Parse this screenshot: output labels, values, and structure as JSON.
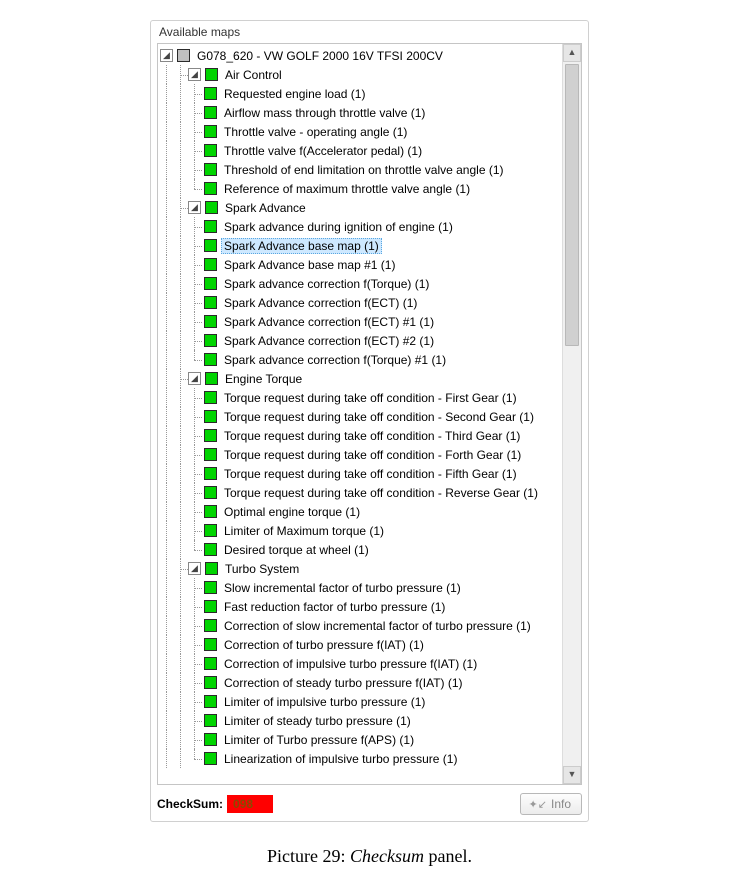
{
  "panel_title": "Available maps",
  "root": {
    "label": "G078_620 - VW GOLF 2000 16V TFSI 200CV",
    "color": "gray"
  },
  "groups": [
    {
      "label": "Air Control",
      "items": [
        "Requested engine load (1)",
        "Airflow mass through throttle valve (1)",
        "Throttle valve - operating angle (1)",
        "Throttle valve f(Accelerator pedal) (1)",
        "Threshold of end limitation on throttle valve angle (1)",
        "Reference of maximum throttle valve angle (1)"
      ]
    },
    {
      "label": "Spark Advance",
      "items": [
        "Spark advance during ignition of engine (1)",
        "Spark Advance base map (1)",
        "Spark Advance base map #1 (1)",
        "Spark advance correction f(Torque) (1)",
        "Spark Advance correction f(ECT) (1)",
        "Spark Advance correction f(ECT) #1 (1)",
        "Spark Advance correction f(ECT) #2 (1)",
        "Spark advance correction f(Torque) #1 (1)"
      ],
      "selected_index": 1
    },
    {
      "label": "Engine Torque",
      "items": [
        "Torque request during take off condition - First Gear (1)",
        "Torque request during take off condition - Second Gear (1)",
        "Torque request during take off condition - Third Gear (1)",
        "Torque request during take off condition - Forth Gear (1)",
        "Torque request during take off condition - Fifth Gear (1)",
        "Torque request during take off condition - Reverse Gear (1)",
        "Optimal engine torque (1)",
        "Limiter of Maximum torque (1)",
        "Desired torque at wheel (1)"
      ]
    },
    {
      "label": "Turbo System",
      "items": [
        "Slow incremental factor of turbo pressure (1)",
        "Fast reduction factor of turbo pressure (1)",
        "Correction of slow incremental factor of turbo pressure (1)",
        "Correction of turbo pressure f(IAT) (1)",
        "Correction of impulsive turbo pressure f(IAT) (1)",
        "Correction of steady turbo pressure f(IAT) (1)",
        "Limiter of impulsive turbo pressure (1)",
        "Limiter of steady turbo pressure (1)",
        "Limiter of Turbo pressure f(APS) (1)",
        "Linearization of impulsive turbo pressure (1)"
      ]
    }
  ],
  "footer": {
    "checksum_label": "CheckSum:",
    "checksum_value": "098",
    "info_label": "Info"
  },
  "caption": {
    "prefix": "Picture 29: ",
    "italic": "Checksum",
    "suffix": " panel."
  }
}
